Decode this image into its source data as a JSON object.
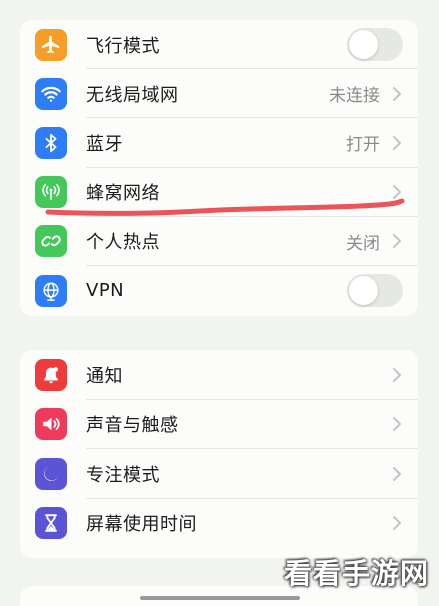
{
  "colors": {
    "airplane": "#f59f2a",
    "wifi": "#2f7df6",
    "bluetooth": "#2f7df6",
    "cellular": "#45c85a",
    "hotspot": "#45c85a",
    "vpn": "#2f7df6",
    "notifications": "#ee3b3b",
    "sounds": "#ee3b5b",
    "focus": "#5b55d6",
    "screentime": "#5b55d6",
    "annotation": "#e8454c"
  },
  "group1": {
    "airplane": {
      "label": "飞行模式",
      "icon": "airplane-icon",
      "toggle": "off"
    },
    "wifi": {
      "label": "无线局域网",
      "value": "未连接",
      "icon": "wifi-icon"
    },
    "bluetooth": {
      "label": "蓝牙",
      "value": "打开",
      "icon": "bluetooth-icon"
    },
    "cellular": {
      "label": "蜂窝网络",
      "value": "",
      "icon": "antenna-icon"
    },
    "hotspot": {
      "label": "个人热点",
      "value": "关闭",
      "icon": "hotspot-icon"
    },
    "vpn": {
      "label": "VPN",
      "icon": "globe-icon",
      "toggle": "off"
    }
  },
  "group2": {
    "notifications": {
      "label": "通知",
      "icon": "bell-icon"
    },
    "sounds": {
      "label": "声音与触感",
      "icon": "speaker-icon"
    },
    "focus": {
      "label": "专注模式",
      "icon": "moon-icon"
    },
    "screentime": {
      "label": "屏幕使用时间",
      "icon": "hourglass-icon"
    }
  },
  "watermark": "看看手游网"
}
